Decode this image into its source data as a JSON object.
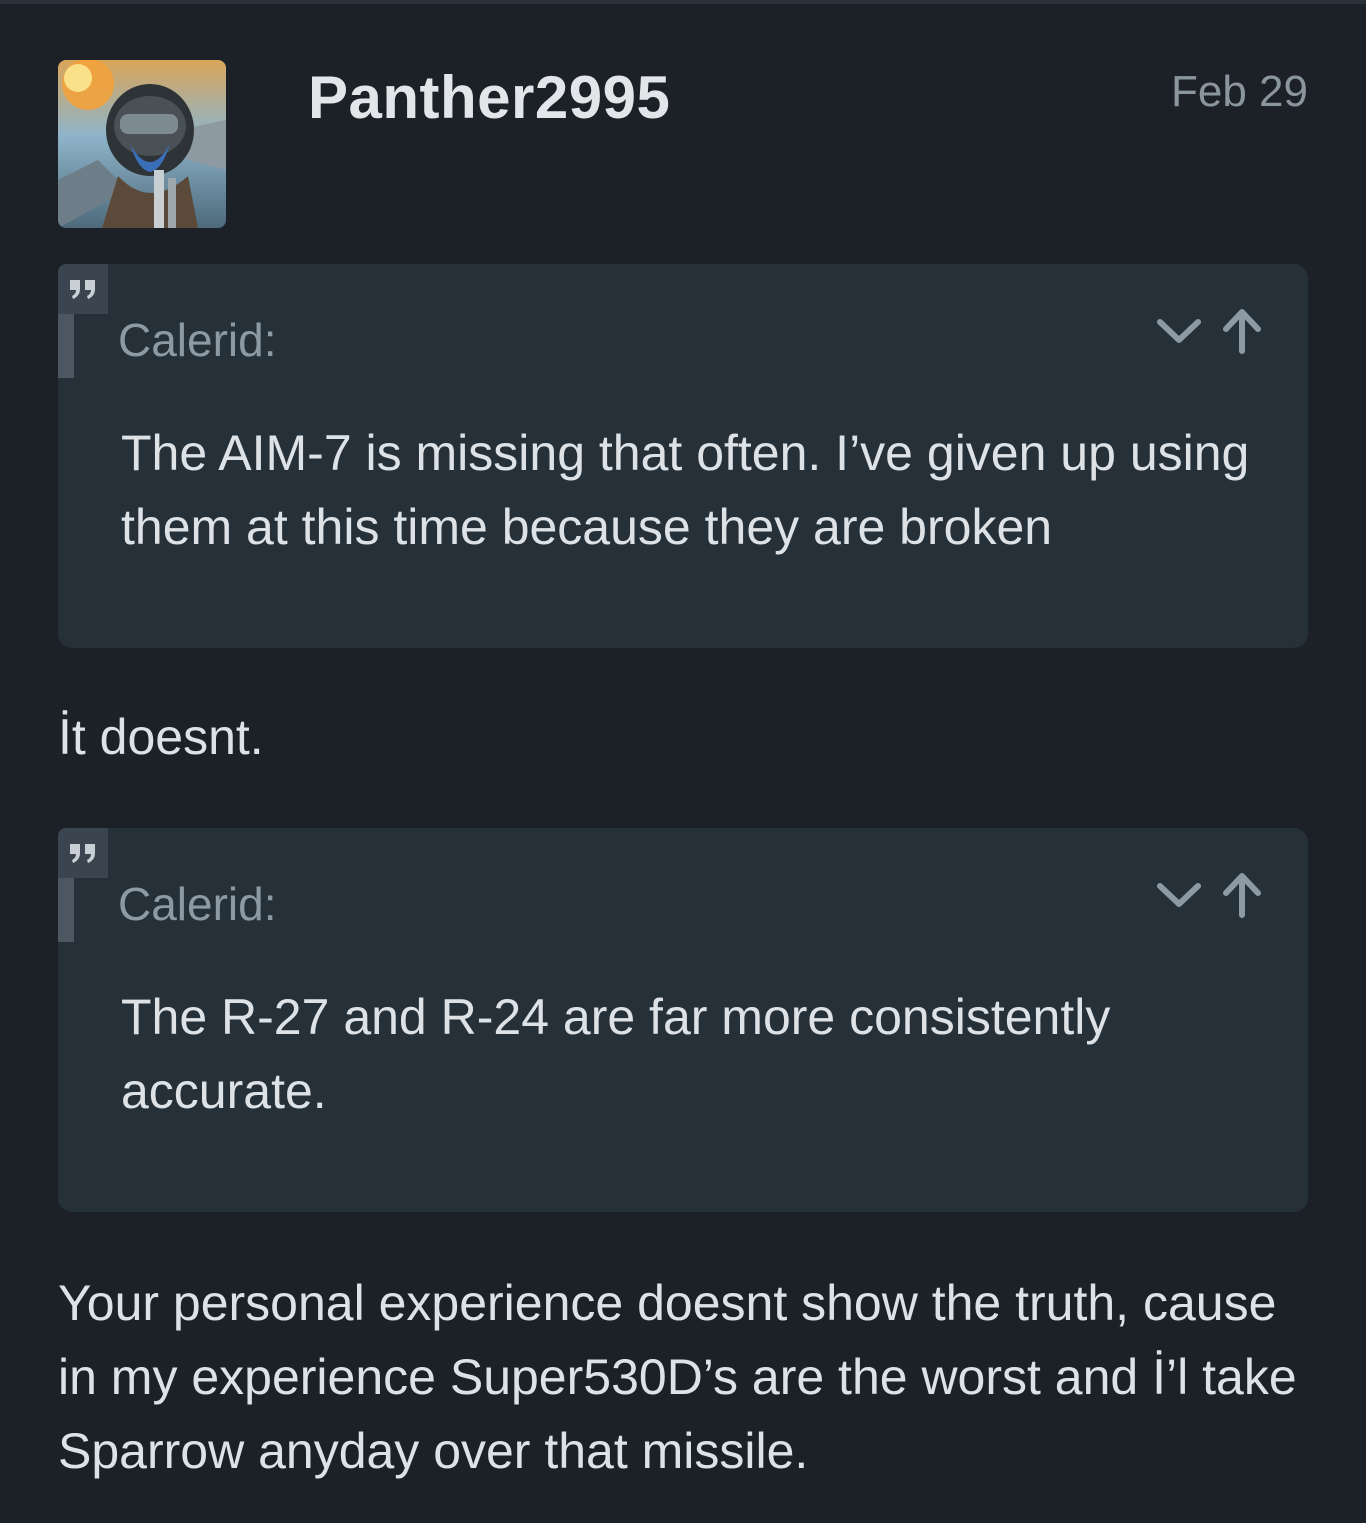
{
  "post": {
    "username": "Panther2995",
    "date": "Feb 29",
    "avatar_icon": "pilot-avatar",
    "quotes": [
      {
        "author": "Calerid:",
        "text": "The AIM-7 is missing that often. I’ve given up using them at this time because they are broken"
      },
      {
        "author": "Calerid:",
        "text": "The R-27 and R-24 are far more consistently accurate."
      }
    ],
    "replies": [
      "İt doesnt.",
      "Your personal experience doesnt show the truth, cause in my experience Super530D’s are the worst and İ’l take Sparrow anyday over that missile."
    ]
  },
  "colors": {
    "background": "#1b2126",
    "quote_background": "#263038",
    "muted_text": "#8a959e",
    "text": "#dde2e6"
  }
}
